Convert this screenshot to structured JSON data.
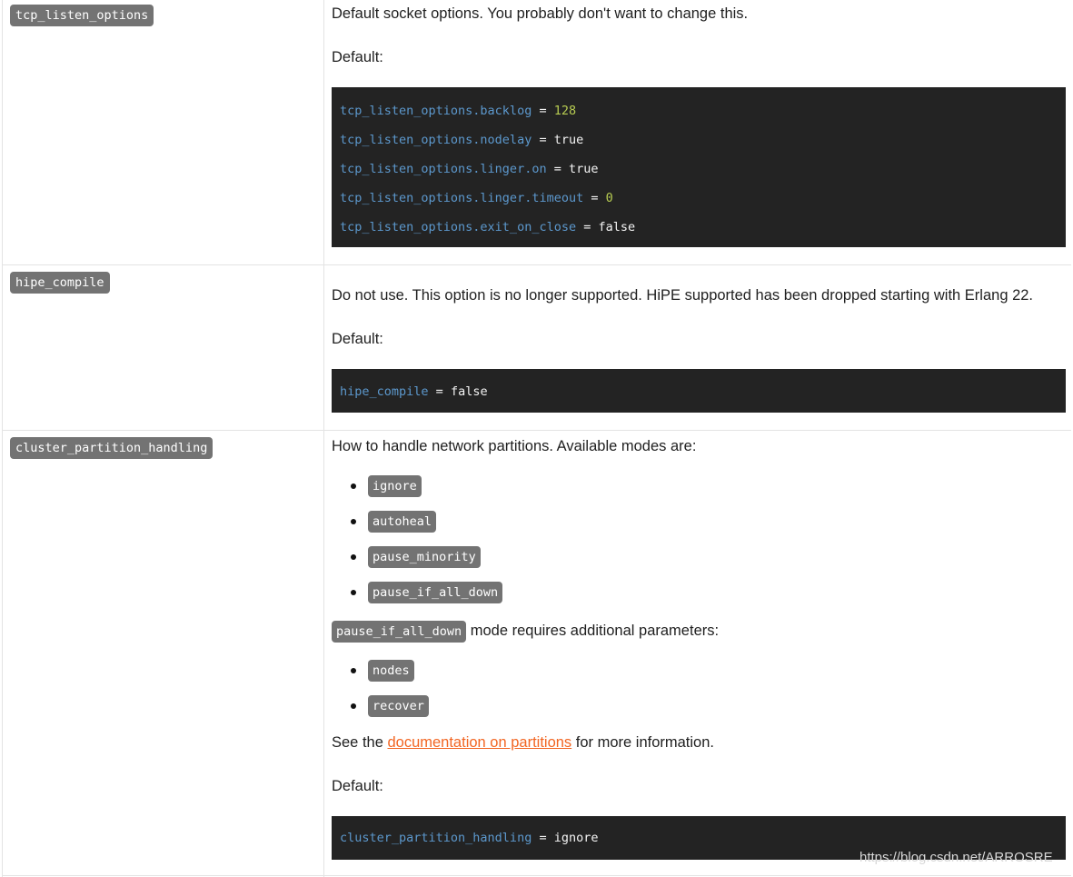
{
  "rows": {
    "tcp": {
      "key": "tcp_listen_options",
      "description": "Default socket options. You probably don't want to change this.",
      "default_label": "Default:",
      "code": [
        {
          "key": "tcp_listen_options.backlog",
          "op": " = ",
          "value": "128"
        },
        {
          "key": "tcp_listen_options.nodelay",
          "op": " = ",
          "value": "true"
        },
        {
          "key": "tcp_listen_options.linger.on",
          "op": " = ",
          "value": "true"
        },
        {
          "key": "tcp_listen_options.linger.timeout",
          "op": " = ",
          "value": "0"
        },
        {
          "key": "tcp_listen_options.exit_on_close",
          "op": " = ",
          "value": "false"
        }
      ]
    },
    "hipe": {
      "key": "hipe_compile",
      "description": "Do not use. This option is no longer supported. HiPE supported has been dropped starting with Erlang 22.",
      "default_label": "Default:",
      "code": [
        {
          "key": "hipe_compile",
          "op": " = ",
          "value": "false"
        }
      ]
    },
    "cluster": {
      "key": "cluster_partition_handling",
      "description": "How to handle network partitions. Available modes are:",
      "modes": [
        "ignore",
        "autoheal",
        "pause_minority",
        "pause_if_all_down"
      ],
      "extra_pill": "pause_if_all_down",
      "extra_text": " mode requires additional parameters:",
      "params": [
        "nodes",
        "recover"
      ],
      "see_prefix": "See the ",
      "see_link": "documentation on partitions",
      "see_suffix": " for more information.",
      "default_label": "Default:",
      "code": [
        {
          "key": "cluster_partition_handling",
          "op": " = ",
          "value": "ignore"
        }
      ]
    }
  },
  "watermark": "https://blog.csdn.net/ARROSRE",
  "colors": {
    "code_bg": "#232323",
    "code_key": "#5c98cd",
    "code_number": "#b7cc52",
    "pill_bg": "#737373",
    "link": "#f26522"
  }
}
